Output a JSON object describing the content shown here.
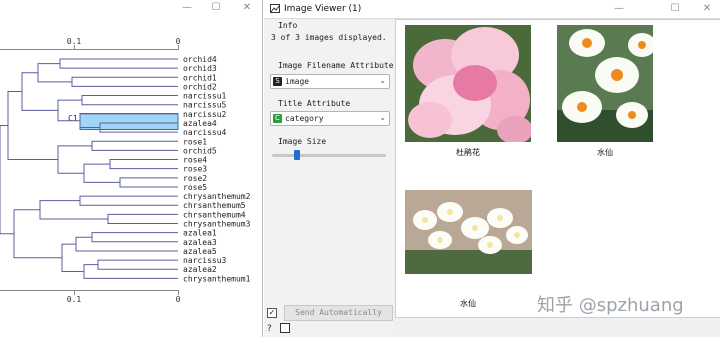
{
  "dendrogram": {
    "axis_ticks": [
      "0.1",
      "0"
    ],
    "cluster_label": "C1",
    "leaves": [
      "orchid4",
      "orchid3",
      "orchid1",
      "orchid2",
      "narcissu1",
      "narcissu5",
      "narcissu2",
      "azalea4",
      "narcissu4",
      "rose1",
      "orchid5",
      "rose4",
      "rose3",
      "rose2",
      "rose5",
      "chrysanthemum2",
      "chrsanthemum5",
      "chrsanthemum4",
      "chrysanthemum3",
      "azalea1",
      "azalea3",
      "azalea5",
      "narcissu3",
      "azalea2",
      "chrysanthemum1"
    ],
    "selected_leaves": [
      "narcissu2",
      "azalea4",
      "narcissu4"
    ],
    "line_color": "#5a5fa0",
    "selection_color": "#9fd6f5"
  },
  "viewer": {
    "window_title": "Image Viewer (1)",
    "info_header": "Info",
    "info_text": "3 of 3 images displayed.",
    "filename_attr_label": "Image Filename Attribute",
    "filename_attr_value": "image",
    "filename_attr_icon": "S",
    "title_attr_label": "Title Attribute",
    "title_attr_value": "category",
    "title_attr_icon": "C",
    "image_size_label": "Image Size",
    "image_size_value": 0.2,
    "send_label": "Send Automatically",
    "send_checked": true,
    "help_glyph": "?",
    "images": [
      {
        "caption": "杜鹃花",
        "subject": "pink-azalea-photo"
      },
      {
        "caption": "水仙",
        "subject": "white-narcissus-photo"
      },
      {
        "caption": "水仙",
        "subject": "white-narcissus-cluster-photo"
      }
    ]
  },
  "window_controls": {
    "minimize": "—",
    "maximize": "☐",
    "close": "✕"
  },
  "watermark": "知乎 @spzhuang"
}
